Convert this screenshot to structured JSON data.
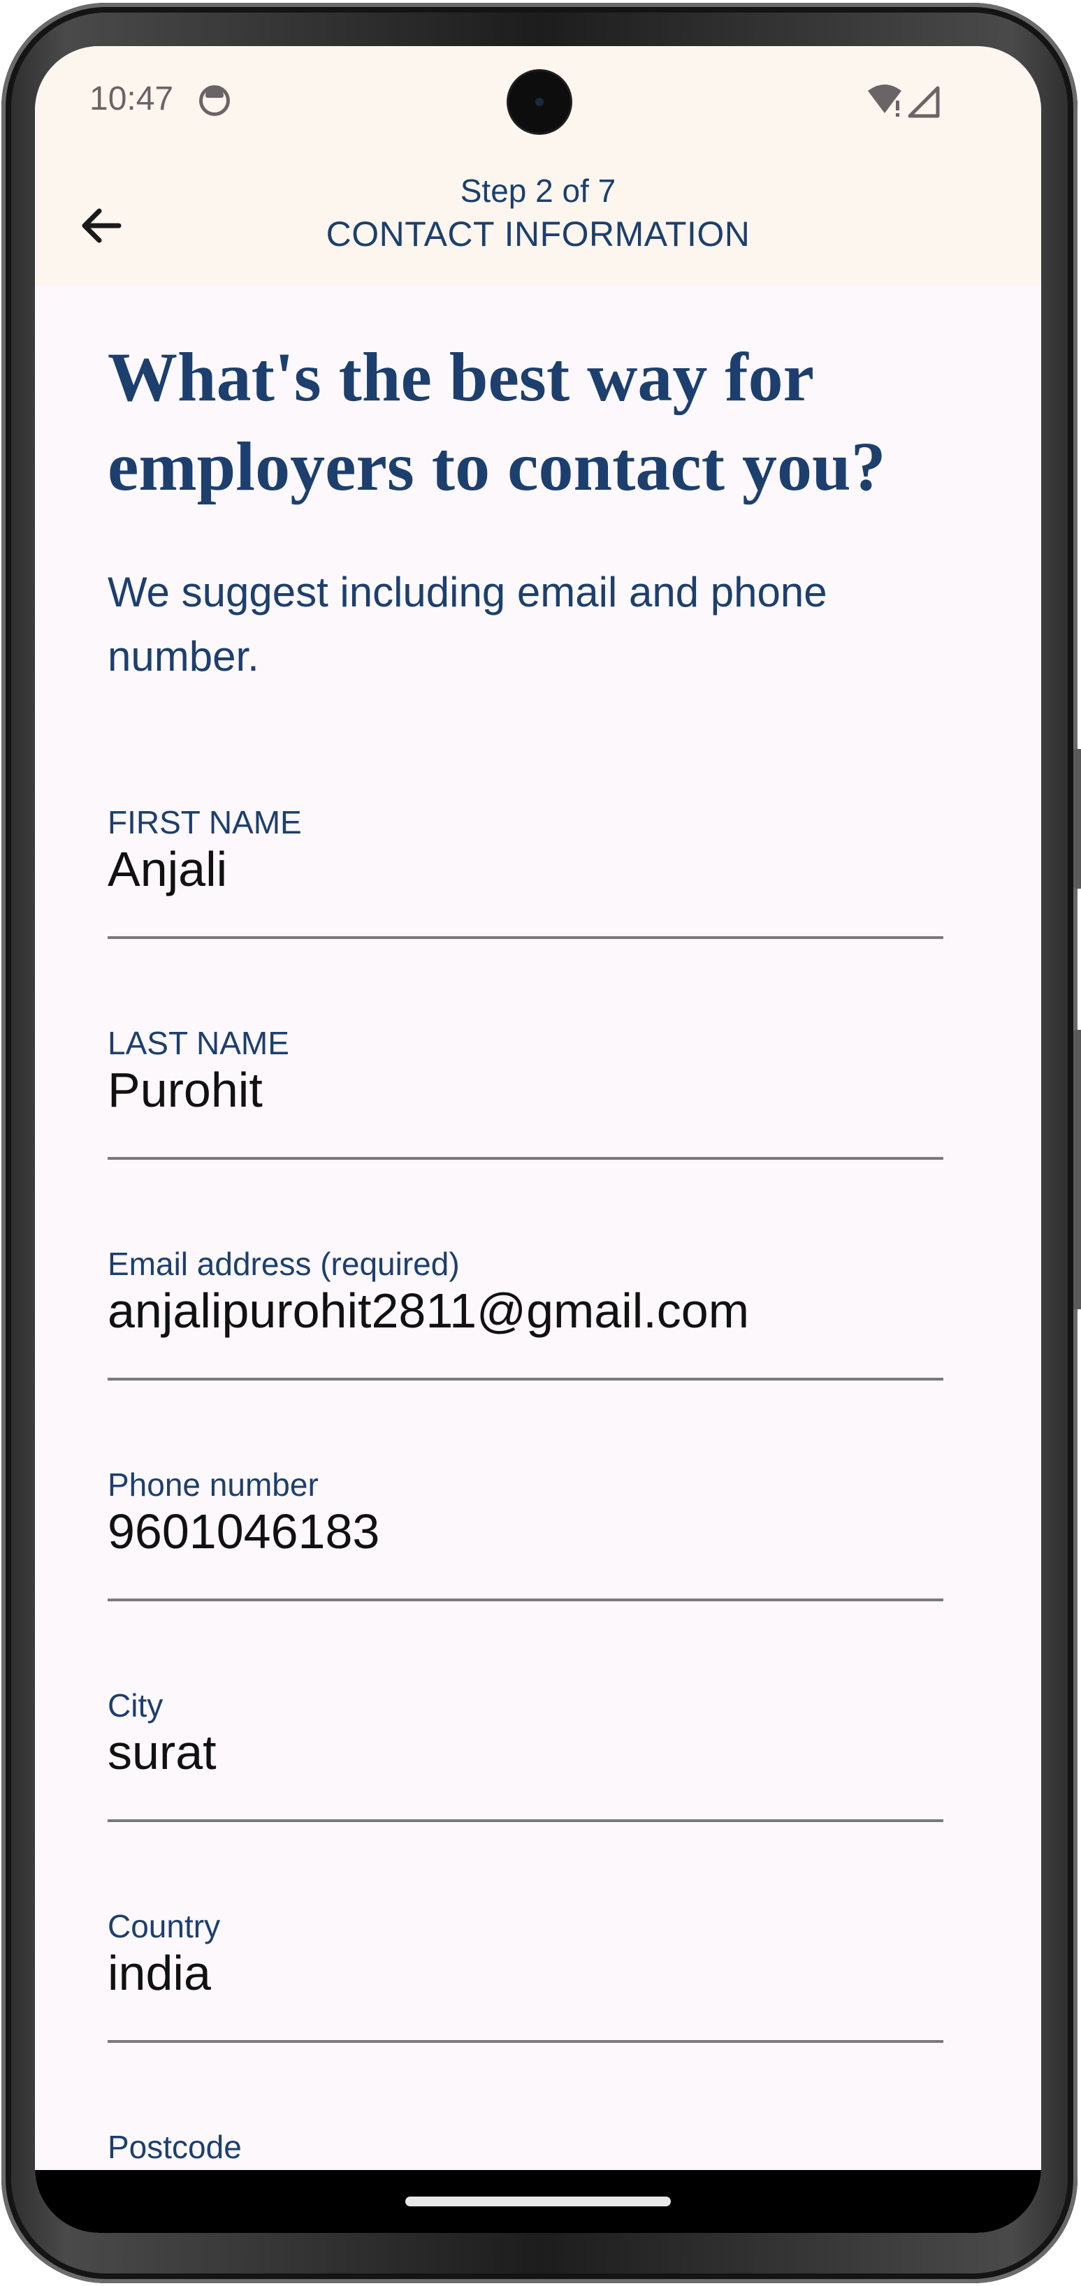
{
  "status_bar": {
    "time": "10:47"
  },
  "header": {
    "step": "Step 2 of 7",
    "title": "CONTACT INFORMATION"
  },
  "headline": "What's the best way for employers to contact you?",
  "subtext": "We suggest including email and phone number.",
  "fields": [
    {
      "label": "FIRST NAME",
      "value": "Anjali"
    },
    {
      "label": "LAST NAME",
      "value": "Purohit"
    },
    {
      "label": "Email address (required)",
      "value": "anjalipurohit2811@gmail.com"
    },
    {
      "label": "Phone number",
      "value": "9601046183"
    },
    {
      "label": "City",
      "value": "surat"
    },
    {
      "label": "Country",
      "value": "india"
    },
    {
      "label": "Postcode",
      "value": ""
    }
  ],
  "colors": {
    "primary": "#1c3f6e",
    "header_bg": "#fdf6ee",
    "page_bg": "#fcf8fb"
  }
}
